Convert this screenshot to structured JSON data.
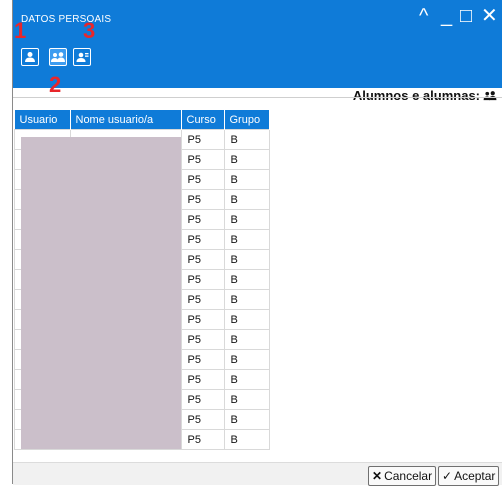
{
  "window": {
    "title": "DATOS PERSOAIS",
    "controls": {
      "collapse": "^",
      "minimize": "_",
      "maximize": "□",
      "close": "✕"
    }
  },
  "toolbar": {
    "buttons": [
      {
        "icon": "person-icon",
        "annotation": "1"
      },
      {
        "icon": "group-icon",
        "annotation": "2",
        "active": true
      },
      {
        "icon": "contact-card-icon",
        "annotation": "3"
      }
    ]
  },
  "info": {
    "label": "Alumnos e alumnas:"
  },
  "table": {
    "columns": [
      "Usuario",
      "Nome usuario/a",
      "Curso",
      "Grupo"
    ],
    "rows": [
      [
        "",
        "",
        "P5",
        "B"
      ],
      [
        "",
        "",
        "P5",
        "B"
      ],
      [
        "",
        "",
        "P5",
        "B"
      ],
      [
        "",
        "",
        "P5",
        "B"
      ],
      [
        "",
        "",
        "P5",
        "B"
      ],
      [
        "",
        "",
        "P5",
        "B"
      ],
      [
        "",
        "",
        "P5",
        "B"
      ],
      [
        "",
        "",
        "P5",
        "B"
      ],
      [
        "",
        "",
        "P5",
        "B"
      ],
      [
        "",
        "",
        "P5",
        "B"
      ],
      [
        "",
        "",
        "P5",
        "B"
      ],
      [
        "",
        "",
        "P5",
        "B"
      ],
      [
        "",
        "",
        "P5",
        "B"
      ],
      [
        "",
        "",
        "P5",
        "B"
      ],
      [
        "",
        "",
        "P5",
        "B"
      ],
      [
        "",
        "",
        "P5",
        "B"
      ]
    ]
  },
  "footer": {
    "cancel_label": "Cancelar",
    "accept_label": "Aceptar"
  },
  "colors": {
    "titlebar": "#0f7bd8",
    "annotation": "#e8262b",
    "redaction": "#cbbfca"
  }
}
